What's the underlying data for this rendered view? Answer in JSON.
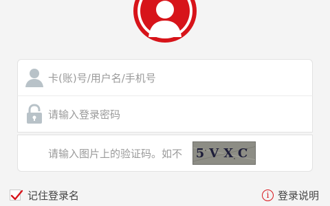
{
  "login": {
    "username_placeholder": "卡(账)号/用户名/手机号",
    "password_placeholder": "请输入登录密码",
    "captcha_placeholder": "请输入图片上的验证码。如不",
    "captcha_text": "5VXC"
  },
  "footer": {
    "remember_label": "记住登录名",
    "remember_checked": true,
    "help_label": "登录说明",
    "help_icon_glyph": "i"
  },
  "colors": {
    "accent": "#d7141a",
    "icon_gray": "#b8c2c8",
    "background": "#f4f4f4"
  },
  "icons": {
    "avatar": "user-avatar-icon",
    "username": "user-icon",
    "password": "lock-icon",
    "remember": "checkmark-icon",
    "help": "info-icon"
  }
}
